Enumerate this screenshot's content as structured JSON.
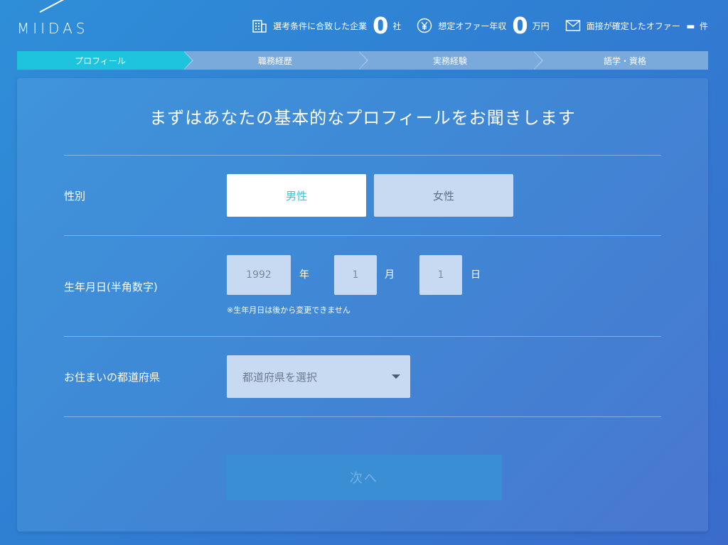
{
  "header": {
    "logo_text": "MIIDAS",
    "stats": [
      {
        "icon": "building-icon",
        "label": "選考条件に合致した企業",
        "value": "0",
        "unit": "社"
      },
      {
        "icon": "yen-icon",
        "label": "想定オファー年収",
        "value": "0",
        "unit": "万円"
      },
      {
        "icon": "mail-icon",
        "label": "面接が確定したオファー",
        "value": "-",
        "unit": "件"
      }
    ]
  },
  "steps": [
    {
      "label": "プロフィール",
      "active": true
    },
    {
      "label": "職務経歴",
      "active": false
    },
    {
      "label": "実務経験",
      "active": false
    },
    {
      "label": "語学・資格",
      "active": false
    }
  ],
  "form": {
    "title": "まずはあなたの基本的なプロフィールをお聞きします",
    "gender": {
      "label": "性別",
      "options": [
        "男性",
        "女性"
      ],
      "selected": "男性"
    },
    "birthday": {
      "label": "生年月日(半角数字)",
      "year_value": "1992",
      "year_unit": "年",
      "month_value": "1",
      "month_unit": "月",
      "day_value": "1",
      "day_unit": "日",
      "note": "※生年月日は後から変更できません"
    },
    "prefecture": {
      "label": "お住まいの都道府県",
      "placeholder": "都道府県を選択"
    },
    "next_label": "次へ"
  },
  "colors": {
    "accent": "#1ec3dd",
    "step_inactive": "#7aa9dc",
    "input_bg": "#c8daf2"
  }
}
